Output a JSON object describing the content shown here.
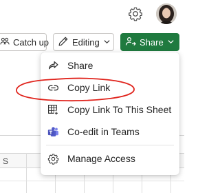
{
  "toolbar": {
    "catchup_label": "Catch up",
    "editing_label": "Editing",
    "share_label": "Share"
  },
  "share_menu": {
    "items": [
      {
        "label": "Share",
        "icon": "share-arrow-icon"
      },
      {
        "label": "Copy Link",
        "icon": "link-icon"
      },
      {
        "label": "Copy Link To This Sheet",
        "icon": "sheet-link-icon"
      },
      {
        "label": "Co-edit in Teams",
        "icon": "teams-icon"
      },
      {
        "label": "Manage Access",
        "icon": "gear-icon"
      }
    ]
  },
  "sheet": {
    "column_label": "S"
  },
  "colors": {
    "share_green": "#1f7a3f",
    "annotation_red": "#e0231c"
  }
}
